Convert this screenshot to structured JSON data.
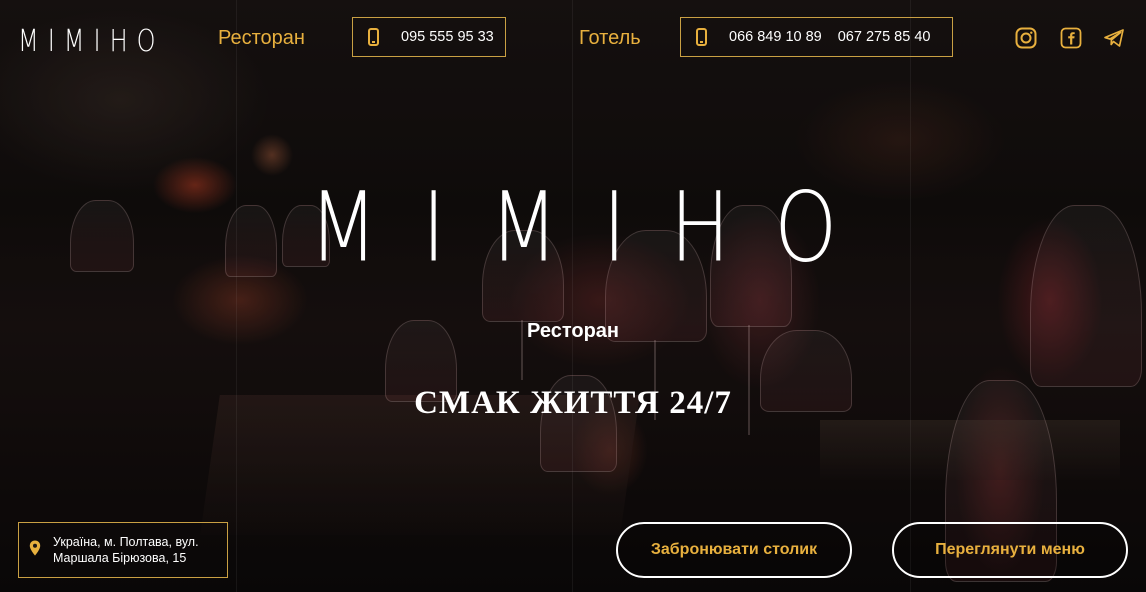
{
  "header": {
    "logo": "MIMIHO",
    "restaurant": {
      "label": "Ресторан",
      "phone": "095 555 95 33"
    },
    "hotel": {
      "label": "Готель",
      "phone_1": "066 849 10 89",
      "phone_2": "067 275 85 40"
    },
    "social": [
      "instagram-icon",
      "facebook-icon",
      "telegram-icon"
    ]
  },
  "hero": {
    "logo": "MIMIHO",
    "subtitle": "Ресторан",
    "slogan": "СМАК ЖИТТЯ 24/7"
  },
  "address": {
    "icon": "location-pin-icon",
    "line_1": "Україна, м. Полтава, вул.",
    "line_2": "Маршала Бірюзова, 15"
  },
  "actions": {
    "book_label": "Забронювати столик",
    "menu_label": "Переглянути меню"
  },
  "colors": {
    "accent": "#e8b03e",
    "border_gold": "#c9a043",
    "text": "#ffffff",
    "background": "#0d0908"
  }
}
